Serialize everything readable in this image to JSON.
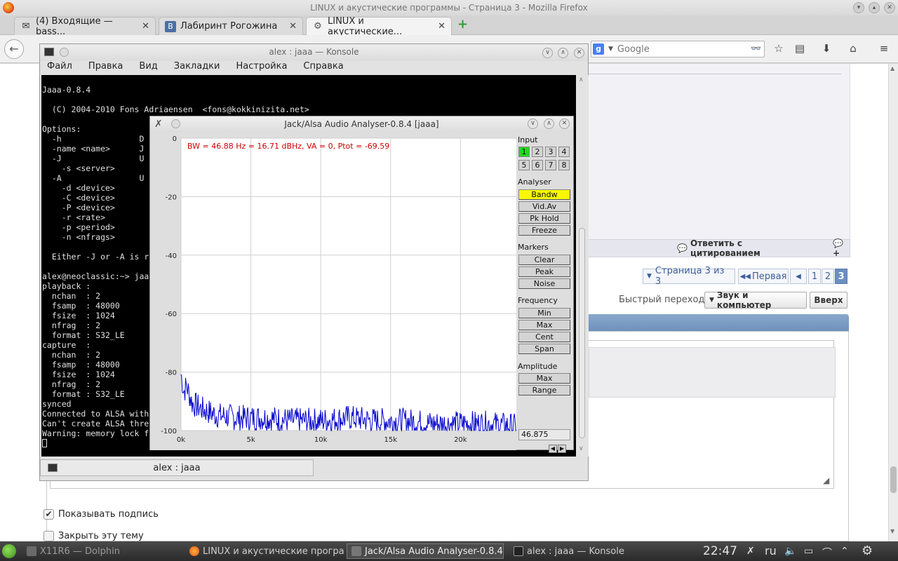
{
  "firefox": {
    "window_title": "LINUX и акустические программы - Страница 3 - Mozilla Firefox",
    "tabs": [
      {
        "label": "(4) Входящие — bass..."
      },
      {
        "label": "Лабиринт Рогожина"
      },
      {
        "label": "LINUX и акустические..."
      }
    ],
    "search": {
      "placeholder": "Google"
    }
  },
  "page": {
    "reply_quote": "Ответить с цитированием",
    "pagination": {
      "summary": "Страница 3 из 3",
      "first": "Первая",
      "pages": [
        "1",
        "2",
        "3"
      ],
      "current": "3"
    },
    "quick_jump_label": "Быстрый переход",
    "quick_jump_value": "Звук и компьютер",
    "top_button": "Вверх",
    "show_signature": "Показывать подпись",
    "close_topic": "Закрыть эту тему"
  },
  "konsole": {
    "title": "alex : jaaa — Konsole",
    "menu": [
      "Файл",
      "Правка",
      "Вид",
      "Закладки",
      "Настройка",
      "Справка"
    ],
    "tab_label": "alex : jaaa",
    "terminal_lines": [
      "Jaaa-0.8.4",
      "",
      "  (C) 2004-2010 Fons Adriaensen  <fons@kokkinizita.net>",
      "",
      "Options:",
      "  -h                D",
      "  -name <name>      J",
      "  -J                U",
      "    -s <server>",
      "  -A                U",
      "    -d <device>",
      "    -C <device>",
      "    -P <device>",
      "    -r <rate>",
      "    -p <period>",
      "    -n <nfrags>",
      "",
      "  Either -J or -A is r",
      "",
      "alex@neoclassic:~> jaa",
      "playback :",
      "  nchan  : 2",
      "  fsamp  : 48000",
      "  fsize  : 1024",
      "  nfrag  : 2",
      "  format : S32_LE",
      "capture  :",
      "  nchan  : 2",
      "  fsamp  : 48000",
      "  fsize  : 1024",
      "  nfrag  : 2",
      "  format : S32_LE",
      "synced",
      "Connected to ALSA with",
      "Can't create ALSA thre",
      "Warning: memory lock f"
    ]
  },
  "jaaa": {
    "title": "Jack/Alsa Audio Analyser-0.8.4  [jaaa]",
    "info_line": "BW = 46.88 Hz = 16.71 dBHz, VA = 0, Ptot = -69.59",
    "input_label": "Input",
    "inputs": [
      "1",
      "2",
      "3",
      "4",
      "5",
      "6",
      "7",
      "8"
    ],
    "active_input": "1",
    "analyser_label": "Analyser",
    "analyser_buttons": [
      "Bandw",
      "Vid.Av",
      "Pk Hold",
      "Freeze"
    ],
    "markers_label": "Markers",
    "markers_buttons": [
      "Clear",
      "Peak",
      "Noise"
    ],
    "frequency_label": "Frequency",
    "frequency_buttons": [
      "Min",
      "Max",
      "Cent",
      "Span"
    ],
    "amplitude_label": "Amplitude",
    "amplitude_buttons": [
      "Max",
      "Range"
    ],
    "value_field": "46.875",
    "colors": {
      "highlight": "#f7f700",
      "input_on": "#22d822",
      "trace": "#0000cc",
      "info_text": "#cc0000"
    }
  },
  "chart_data": {
    "type": "line",
    "xlabel": "",
    "ylabel": "",
    "x_ticks": [
      "0k",
      "5k",
      "10k",
      "15k",
      "20k"
    ],
    "y_ticks": [
      "0",
      "-20",
      "-40",
      "-60",
      "-80",
      "-100"
    ],
    "xlim": [
      0,
      24000
    ],
    "ylim": [
      -100,
      0
    ],
    "grid": true,
    "series": [
      {
        "values_hz_db": [
          [
            0,
            -82
          ],
          [
            200,
            -88
          ],
          [
            400,
            -86
          ],
          [
            800,
            -92
          ],
          [
            1500,
            -94
          ],
          [
            2500,
            -96
          ],
          [
            4000,
            -97
          ],
          [
            6000,
            -97
          ],
          [
            8000,
            -98
          ],
          [
            10000,
            -98
          ],
          [
            12000,
            -97
          ],
          [
            14000,
            -98
          ],
          [
            16000,
            -98
          ],
          [
            18000,
            -99
          ],
          [
            20000,
            -99
          ],
          [
            22000,
            -99
          ],
          [
            24000,
            -100
          ]
        ]
      }
    ]
  },
  "taskbar": {
    "items": [
      {
        "label": "X11R6 — Dolphin"
      },
      {
        "label": "LINUX и акустические програ"
      },
      {
        "label": "Jack/Alsa Audio Analyser-0.8.4"
      },
      {
        "label": "alex : jaaa — Konsole"
      }
    ],
    "clock": "22:47",
    "keyboard_layout": "ru"
  }
}
